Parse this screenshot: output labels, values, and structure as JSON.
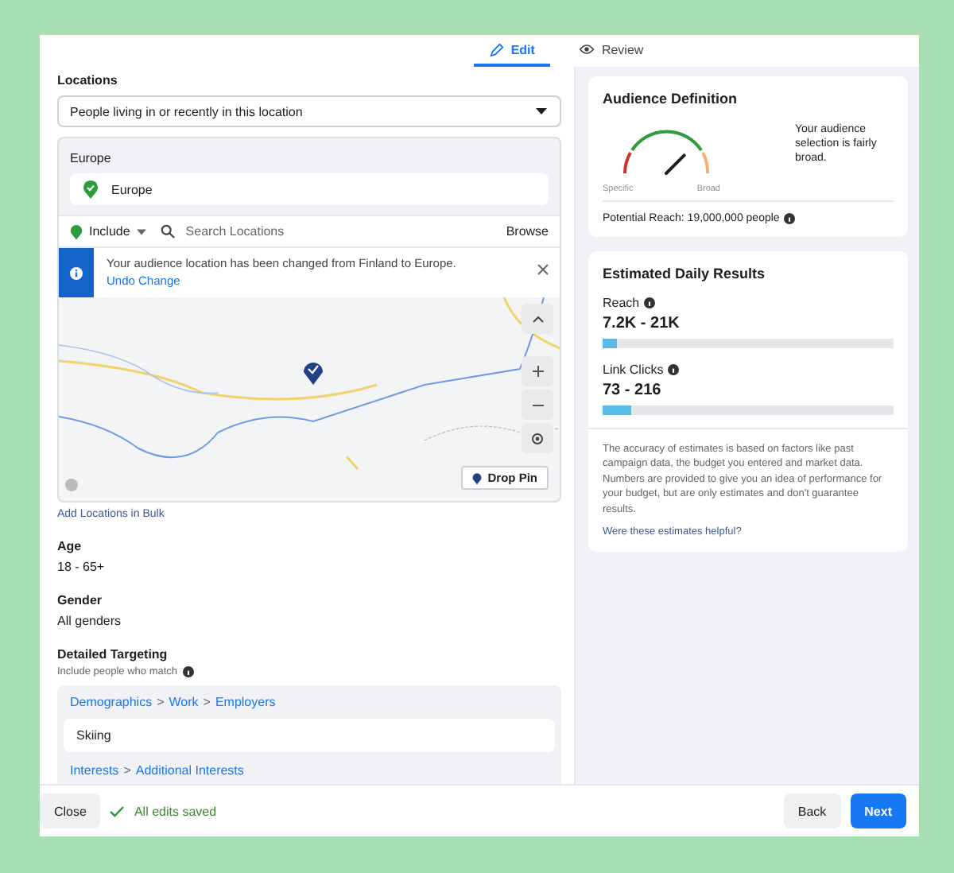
{
  "tabs": [
    {
      "label": "Edit",
      "selected": true
    },
    {
      "label": "Review",
      "selected": false
    }
  ],
  "locations": {
    "label": "Locations",
    "dropdown": "People living in or recently in this location",
    "group_title": "Europe",
    "selected_location": "Europe",
    "include": "Include",
    "search_placeholder": "Search Locations",
    "browse": "Browse",
    "notice": {
      "text": "Your audience location has been changed from Finland to Europe.",
      "link": "Undo Change"
    },
    "drop_pin": "Drop Pin",
    "bulk_link": "Add Locations in Bulk"
  },
  "age": {
    "label": "Age",
    "value": "18 - 65+"
  },
  "gender": {
    "label": "Gender",
    "value": "All genders"
  },
  "detailed_targeting": {
    "label": "Detailed Targeting",
    "hint": "Include people who match",
    "groups": [
      {
        "path": [
          "Demographics",
          "Work",
          "Employers"
        ],
        "separator": ">",
        "items": [
          "Skiing"
        ]
      },
      {
        "path": [
          "Interests",
          "Additional Interests"
        ],
        "separator": ">"
      }
    ]
  },
  "audience_definition": {
    "title": "Audience Definition",
    "gauge": {
      "low_label": "Specific",
      "high_label": "Broad"
    },
    "description": "Your audience selection is fairly broad.",
    "potential_reach": "Potential Reach: 19,000,000 people"
  },
  "estimated_results": {
    "title": "Estimated Daily Results",
    "metrics": [
      {
        "label": "Reach",
        "value": "7.2K - 21K",
        "level": 0.05
      },
      {
        "label": "Link Clicks",
        "value": "73 - 216",
        "level": 0.1
      }
    ],
    "disclaimer": "The accuracy of estimates is based on factors like past campaign data, the budget you entered and market data. Numbers are provided to give you an idea of performance for your budget, but are only estimates and don't guarantee results.",
    "feedback_link": "Were these estimates helpful?"
  },
  "footer": {
    "close": "Close",
    "status": "All edits saved",
    "back": "Back",
    "next": "Next"
  }
}
